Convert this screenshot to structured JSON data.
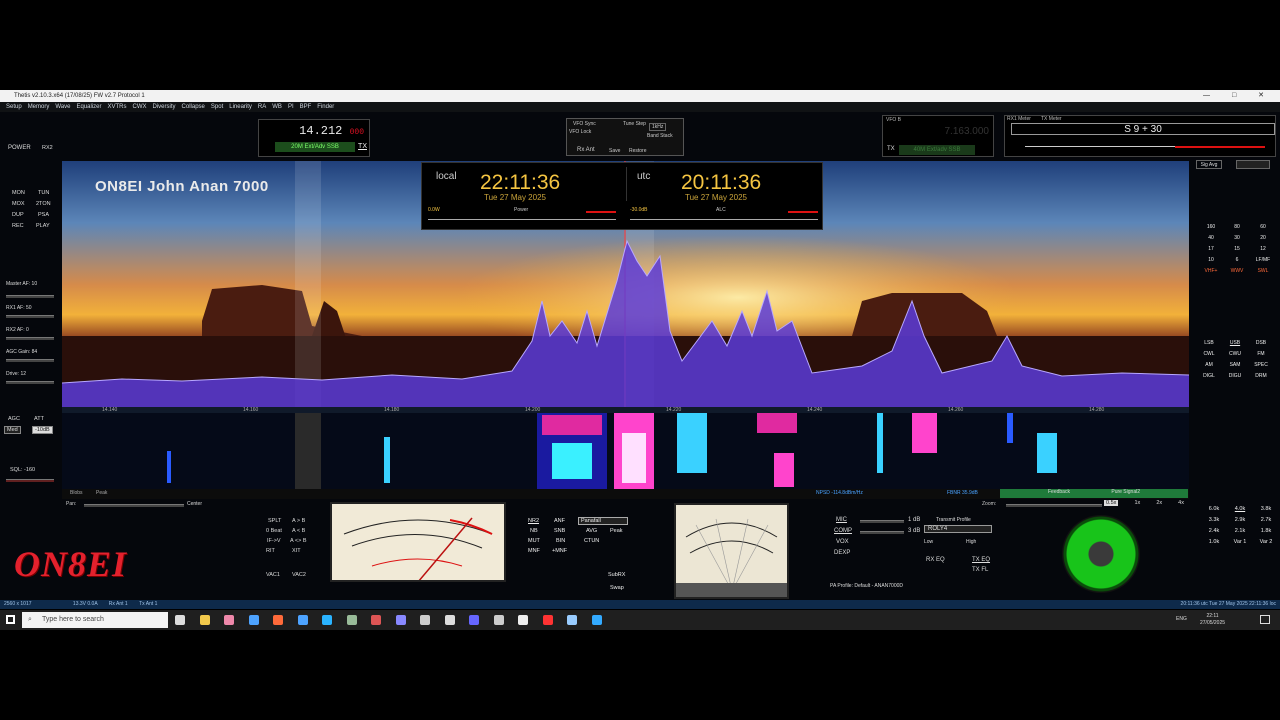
{
  "titlebar": {
    "title": "Thetis v2.10.3.x64 (17/08/25) FW v2.7 Protocol 1"
  },
  "menu": [
    "Setup",
    "Memory",
    "Wave",
    "Equalizer",
    "XVTRs",
    "CWX",
    "Diversity",
    "Collapse",
    "Spot",
    "Linearity",
    "RA",
    "WB",
    "PI",
    "BPF",
    "Finder"
  ],
  "vfoA": {
    "freq_main": "14.212",
    "freq_sub": "000",
    "mode": "20M Ext/Adv SSB",
    "tx": "TX"
  },
  "vfoSync": {
    "title": "VFO Sync",
    "lock": "VFO Lock",
    "tune": "Tune Step",
    "step": "1kHz",
    "band": "Band Stack",
    "rxant": "Rx Ant",
    "save": "Save",
    "restore": "Restore"
  },
  "vfoB": {
    "label": "VFO B",
    "freq": "7.163.000",
    "mode": "40M Ext/adv SSB",
    "tx": "TX"
  },
  "rxMeter": {
    "label1": "RX1 Meter",
    "label2": "TX Meter",
    "reading": "S 9 + 30",
    "mode": "Sig Avg"
  },
  "left": {
    "power": "POWER",
    "rx2": "RX2",
    "buttons": [
      "MON",
      "TUN",
      "MOX",
      "2TON",
      "DUP",
      "PSA",
      "REC",
      "PLAY"
    ],
    "masterAF": "Master AF: 10",
    "rx1af": "RX1 AF: 50",
    "rx2af": "RX2 AF: 0",
    "agcgain": "AGC Gain: 84",
    "drive": "Drive: 12",
    "agc": "AGC",
    "att": "ATT",
    "agcmode": "Med",
    "attval": "-10dB",
    "sql": "SQL: -160"
  },
  "display": {
    "callsign": "ON8EI John Anan 7000",
    "ticks": [
      "14.140",
      "14.160",
      "14.180",
      "14.200",
      "14.220",
      "14.240",
      "14.260",
      "14.280"
    ]
  },
  "clock": {
    "local_label": "local",
    "local_time": "22:11:36",
    "local_date": "Tue 27 May 2025",
    "utc_label": "utc",
    "utc_time": "20:11:36",
    "utc_date": "Tue 27 May 2025",
    "power_label": "Power",
    "power_val": "0.0W",
    "alc_label": "ALC",
    "alc_val": "-30.0dB"
  },
  "bands": [
    "160",
    "80",
    "60",
    "40",
    "30",
    "20",
    "17",
    "15",
    "12",
    "10",
    "6",
    "LF/MF",
    "VHF+",
    "WWV",
    "SWL"
  ],
  "modes": [
    "LSB",
    "USB",
    "DSB",
    "CWL",
    "CWU",
    "FM",
    "AM",
    "SAM",
    "SPEC",
    "DIGL",
    "DIGU",
    "DRM"
  ],
  "bottom": {
    "blobs": "Blobs",
    "peak": "Peak",
    "pan": "Pan:",
    "center": "Center",
    "npsd": "NPSD -114.8dBm/Hz",
    "fbnr": "FBNR 35.9dB",
    "zoom": "Zoom:",
    "zoomopts": [
      "0.5x",
      "1x",
      "2x",
      "4x"
    ],
    "feedback": "Feedback",
    "pureSignal": "Pure Signal2"
  },
  "logo": "ON8EI",
  "controls": {
    "splt": "SPLT",
    "atob": "A > B",
    "zbeat": "0 Beat",
    "atob2": "A < B",
    "ifv": "IF->V",
    "aswapb": "A <> B",
    "rit": "RIT",
    "xit": "XIT",
    "vac1": "VAC1",
    "vac2": "VAC2",
    "nr2": "NR2",
    "anf": "ANF",
    "nb": "NB",
    "snb": "SNB",
    "avg": "AVG",
    "mut": "MUT",
    "bin": "BIN",
    "ctun": "CTUN",
    "mnf": "MNF",
    "mnfplus": "+MNF",
    "subrx": "SubRX",
    "swap": "Swap",
    "peak": "Peak",
    "panafall": "Panafall"
  },
  "tx": {
    "mic": "MIC",
    "comp": "COMP",
    "vox": "VOX",
    "dexp": "DEXP",
    "db1": "1 dB",
    "db2": "3 dB",
    "profile_label": "Transmit Profile",
    "profile": "ROLY4",
    "low": "Low",
    "high": "High",
    "rxeq": "RX EQ",
    "txeq": "TX EQ",
    "txfl": "TX FL",
    "pa": "PA Profile: Default - ANAN7000D"
  },
  "filters": [
    "6.0k",
    "4.0k",
    "3.8k",
    "3.3k",
    "2.9k",
    "2.7k",
    "2.4k",
    "2.1k",
    "1.8k",
    "1.0k",
    "Var 1",
    "Var 2"
  ],
  "statusbar": {
    "left": "2560 x 1017",
    "mid": "13.3V 0.0A",
    "rx": "Rx Ant 1",
    "tx": "Tx Ant 1",
    "time": "20:11:36 utc  Tue 27 May 2025  22:11:36 loc"
  },
  "taskbar": {
    "search": "Type here to search",
    "clock_time": "22:11",
    "clock_date": "27/05/2025",
    "lang": "ENG"
  }
}
